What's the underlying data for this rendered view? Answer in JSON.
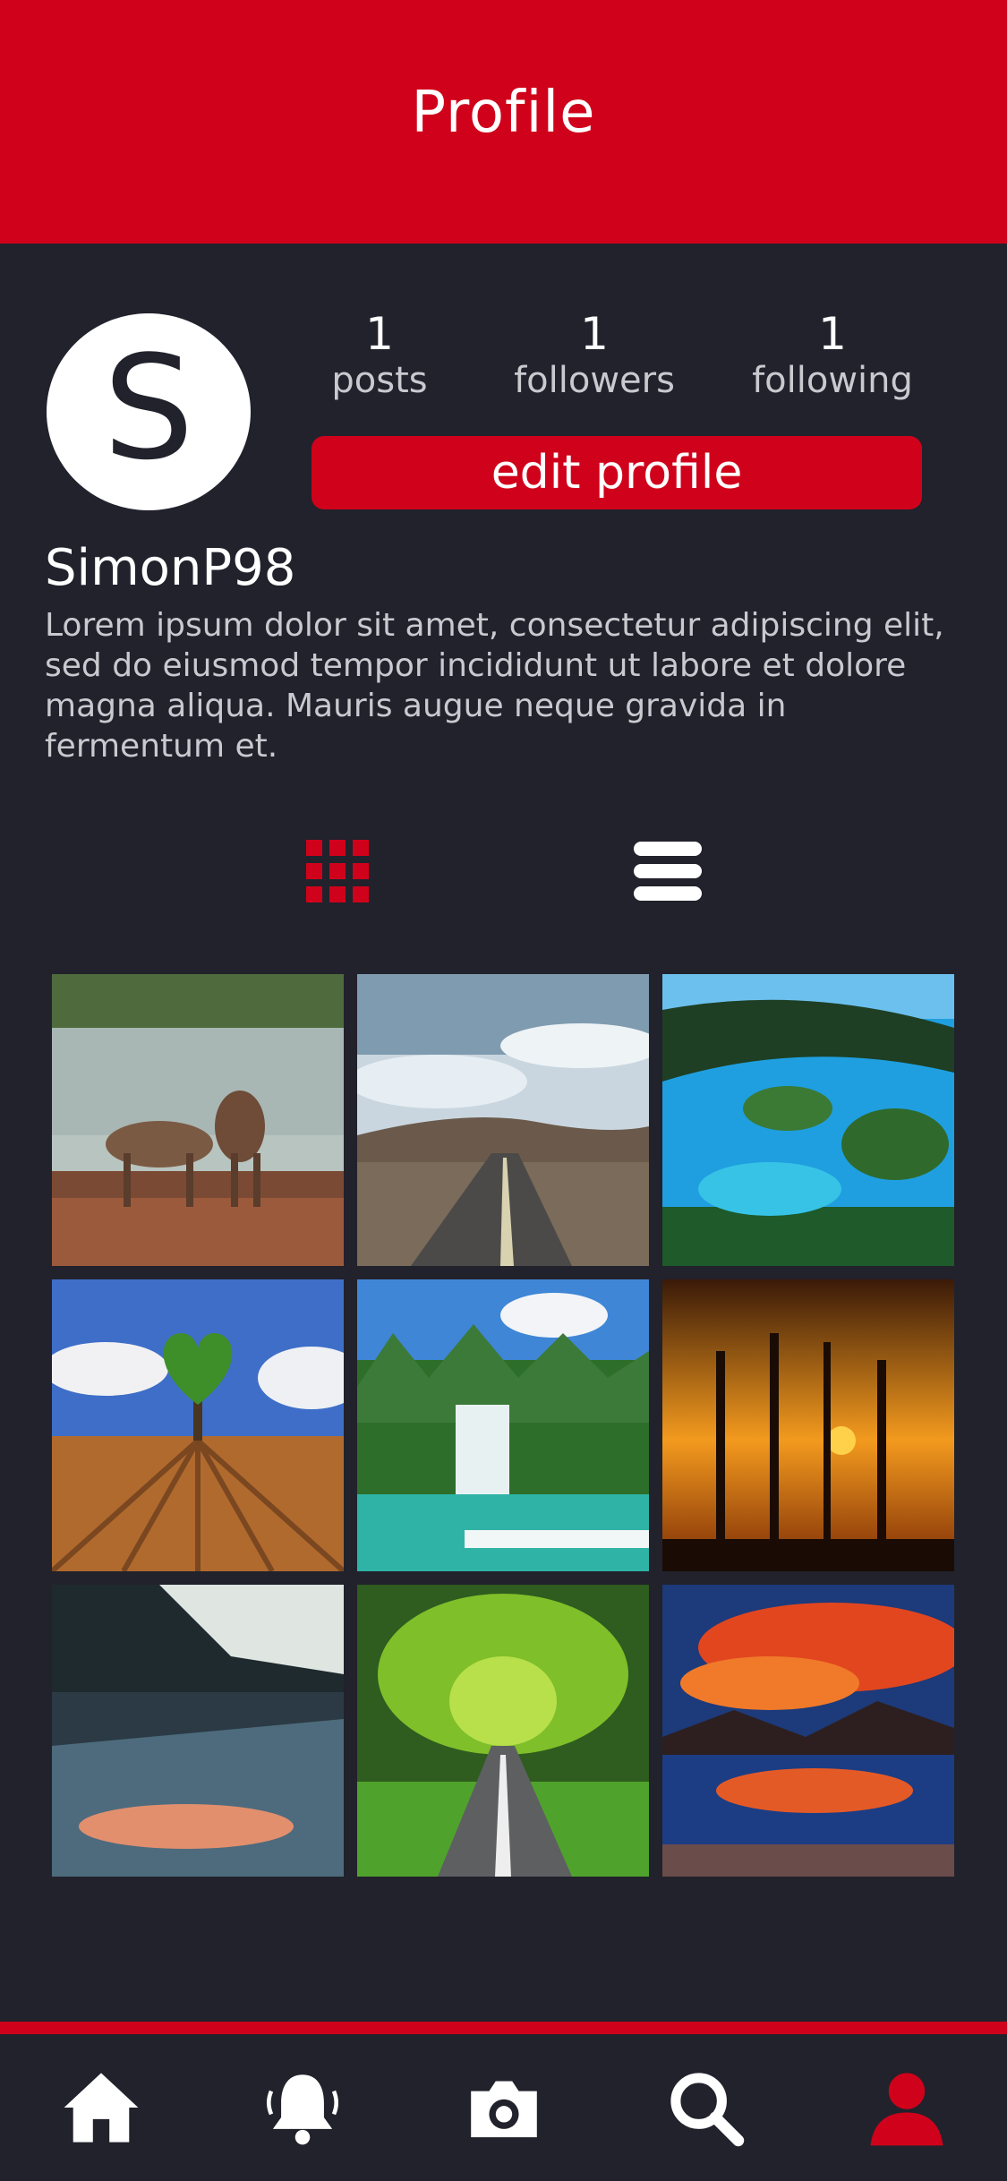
{
  "header": {
    "title": "Profile"
  },
  "profile": {
    "avatar_letter": "S",
    "username": "SimonP98",
    "bio": "Lorem ipsum dolor sit amet, consectetur adipiscing elit, sed do eiusmod tempor incididunt ut labore et dolore magna aliqua. Mauris augue neque gravida in fermentum et.",
    "edit_label": "edit profile"
  },
  "stats": [
    {
      "value": "1",
      "label": "posts"
    },
    {
      "value": "1",
      "label": "followers"
    },
    {
      "value": "1",
      "label": "following"
    }
  ],
  "view_toggle": [
    {
      "icon": "grid-view-icon",
      "active": true
    },
    {
      "icon": "list-view-icon",
      "active": false
    }
  ],
  "photos": [
    {
      "icon": "deer-photo"
    },
    {
      "icon": "road-hills-photo"
    },
    {
      "icon": "lagoon-islands-photo"
    },
    {
      "icon": "heart-tree-field-photo"
    },
    {
      "icon": "waterfall-photo"
    },
    {
      "icon": "sunset-trees-photo"
    },
    {
      "icon": "lake-reflection-photo"
    },
    {
      "icon": "tree-tunnel-road-photo"
    },
    {
      "icon": "red-sky-lake-photo"
    }
  ],
  "tabbar": [
    {
      "icon": "home-icon",
      "active": false
    },
    {
      "icon": "bell-icon",
      "active": false
    },
    {
      "icon": "camera-icon",
      "active": false
    },
    {
      "icon": "search-icon",
      "active": false
    },
    {
      "icon": "profile-icon",
      "active": true
    }
  ],
  "colors": {
    "accent": "#d0021b",
    "background": "#21222c",
    "text": "#ffffff",
    "muted": "#c9c9cf"
  }
}
